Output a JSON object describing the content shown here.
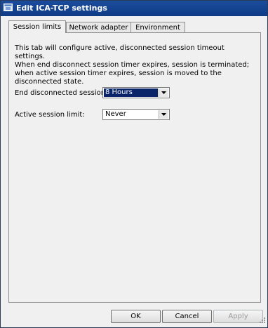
{
  "window": {
    "title": "Edit ICA-TCP settings",
    "icon": "app-window-icon"
  },
  "tabs": [
    {
      "label": "Session limits",
      "active": true
    },
    {
      "label": "Network adapter",
      "active": false
    },
    {
      "label": "Environment",
      "active": false
    }
  ],
  "panel": {
    "description_line1": "This tab will configure active, disconnected  session timeout settings.",
    "description_line2": "When end disconnect session timer expires, session is terminated; when active session timer expires, session is moved to the disconnected state.",
    "end_disconnected_label": "End disconnected session:",
    "end_disconnected_value": "8 Hours",
    "active_limit_label": "Active session limit:",
    "active_limit_value": "Never"
  },
  "buttons": {
    "ok": "OK",
    "cancel": "Cancel",
    "apply": "Apply"
  },
  "colors": {
    "titlebar": "#0e3b86",
    "selection": "#0a246a"
  }
}
